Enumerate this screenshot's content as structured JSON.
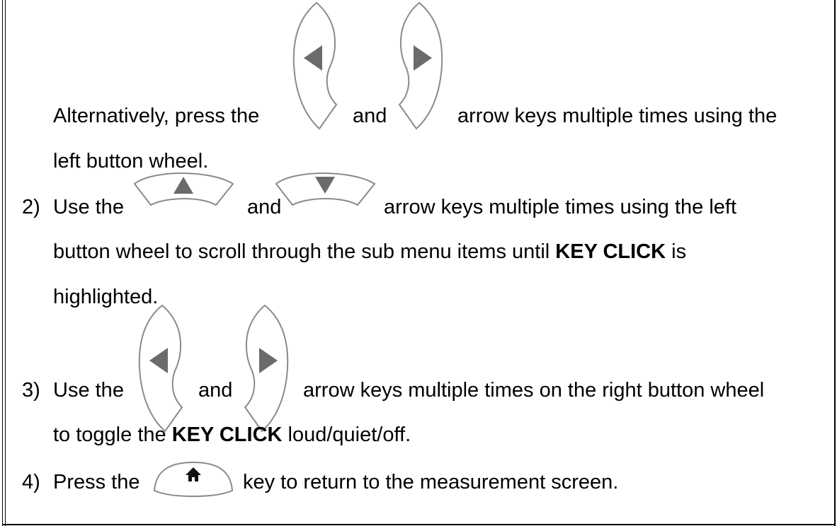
{
  "paragraph_1": {
    "prefix": "Alternatively, press the",
    "conj": "and",
    "suffix": "arrow keys multiple times using the",
    "line2": "left button wheel.",
    "keys": [
      "left-arrow-key",
      "right-arrow-key"
    ]
  },
  "step_2": {
    "number": "2)",
    "prefix": "Use the",
    "conj": "and",
    "suffix": "arrow keys multiple times using the left",
    "line2_a": "button wheel to scroll through the sub menu items until",
    "line2_bold": "KEY CLICK",
    "line2_b": "is",
    "line3": "highlighted.",
    "keys": [
      "up-arrow-key",
      "down-arrow-key"
    ]
  },
  "step_3": {
    "number": "3)",
    "prefix": "Use the",
    "conj": "and",
    "suffix": "arrow keys multiple times on the right button wheel",
    "line2_a": "to toggle the",
    "line2_bold": "KEY CLICK",
    "line2_b": "loud/quiet/off.",
    "keys": [
      "left-arrow-key",
      "right-arrow-key"
    ]
  },
  "step_4": {
    "number": "4)",
    "prefix": "Press the",
    "suffix": "key to return to the measurement screen.",
    "keys": [
      "home-key"
    ]
  },
  "colors": {
    "key_outline": "#8a8a8a",
    "key_arrow": "#6b6b6b",
    "home_glyph": "#111111"
  }
}
